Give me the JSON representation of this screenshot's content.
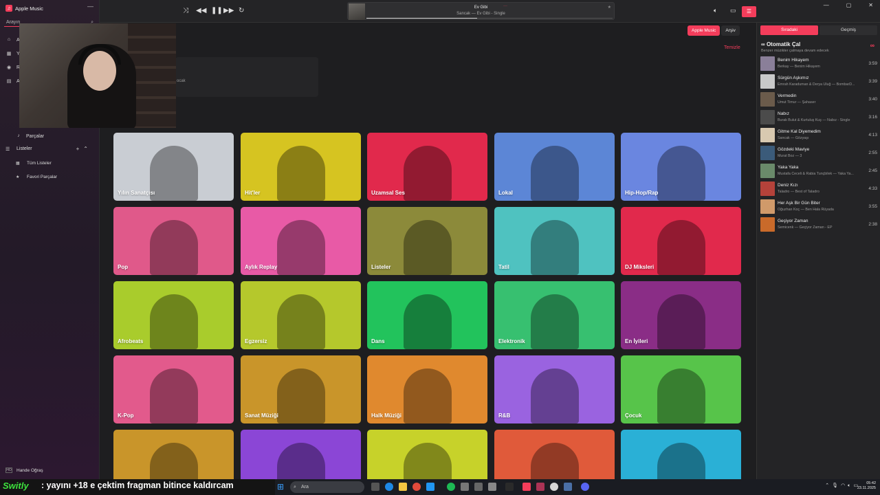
{
  "app": {
    "title": "Apple Music"
  },
  "sidebar": {
    "search_placeholder": "Arayın",
    "nav": [
      {
        "label": "A",
        "icon": "home-icon"
      },
      {
        "label": "Y",
        "icon": "grid-icon"
      },
      {
        "label": "R",
        "icon": "radio-icon"
      },
      {
        "label": "A",
        "icon": "library-icon"
      }
    ],
    "songs_label": "Parçalar",
    "playlists_label": "Listeler",
    "playlists": [
      {
        "label": "Tüm Listeler",
        "icon": "grid-icon"
      },
      {
        "label": "Favori Parçalar",
        "icon": "star-icon"
      }
    ],
    "user": "Hande Oğraş"
  },
  "player": {
    "title": "Ev Gibi",
    "subtitle": "Sancak — Ev Gibi - Single",
    "progress": 0.45
  },
  "content": {
    "toggle_apple": "Apple Music",
    "toggle_archive": "Arşiv",
    "clear": "Temizle",
    "recent_fragment": "ocak"
  },
  "tiles": [
    {
      "label": "Yılın Sanatçısı",
      "color": "#c9cdd3"
    },
    {
      "label": "Hit'ler",
      "color": "#d6c421"
    },
    {
      "label": "Uzamsal Ses",
      "color": "#e1294c"
    },
    {
      "label": "Lokal",
      "color": "#5c86d6"
    },
    {
      "label": "Hip-Hop/Rap",
      "color": "#6a86e0"
    },
    {
      "label": "Pop",
      "color": "#e0598a"
    },
    {
      "label": "Aylık Replay",
      "color": "#e85aa6"
    },
    {
      "label": "Listeler",
      "color": "#8c8a3a"
    },
    {
      "label": "Tatil",
      "color": "#4fc2c0"
    },
    {
      "label": "DJ Miksleri",
      "color": "#e1294c"
    },
    {
      "label": "Afrobeats",
      "color": "#a9cc2c"
    },
    {
      "label": "Egzersiz",
      "color": "#b5c82c"
    },
    {
      "label": "Dans",
      "color": "#22c35c"
    },
    {
      "label": "Elektronik",
      "color": "#37c070"
    },
    {
      "label": "En İyileri",
      "color": "#8a2d86"
    },
    {
      "label": "K-Pop",
      "color": "#e25a8c"
    },
    {
      "label": "Sanat Müziği",
      "color": "#c9952a"
    },
    {
      "label": "Halk Müziği",
      "color": "#e0892e"
    },
    {
      "label": "R&B",
      "color": "#9a63e0"
    },
    {
      "label": "Çocuk",
      "color": "#57c44a"
    },
    {
      "label": "",
      "color": "#c9952a"
    },
    {
      "label": "",
      "color": "#8b46d6"
    },
    {
      "label": "",
      "color": "#c7d22a"
    },
    {
      "label": "",
      "color": "#e05a3a"
    },
    {
      "label": "",
      "color": "#2ab0d6"
    }
  ],
  "queue": {
    "tab_next": "Sıradaki",
    "tab_history": "Geçmiş",
    "autoplay_title": "Otomatik Çal",
    "autoplay_sub": "Benzer müzikler çalmaya devam edecek",
    "items": [
      {
        "title": "Benim Hikayem",
        "sub": "Berkay — Benim Hikayem",
        "dur": "3:59",
        "color": "#8a7f99"
      },
      {
        "title": "Sürgün Aşkımız",
        "sub": "Emrah Karaduman & Derya Uluğ — BombarD...",
        "dur": "3:39",
        "color": "#c9c9c9"
      },
      {
        "title": "Vermedin",
        "sub": "Umut Timur — Şahaser",
        "dur": "3:40",
        "color": "#6b5b4b"
      },
      {
        "title": "Nabız",
        "sub": "Burak Bulut & Kurtuluş Kuş — Nabız - Single",
        "dur": "3:16",
        "color": "#4b4b4b"
      },
      {
        "title": "Gitme Kal Diyemedim",
        "sub": "Sancak — Gözyaşı",
        "dur": "4:13",
        "color": "#d8c9b0"
      },
      {
        "title": "Gözdeki Maviye",
        "sub": "Murat Boz — 3",
        "dur": "2:55",
        "color": "#3b5b7a"
      },
      {
        "title": "Yaka Yaka",
        "sub": "Mustafa Ceceli & Rabia Tunçbilek — Yaka Ya...",
        "dur": "2:45",
        "color": "#6a8a6a"
      },
      {
        "title": "Deniz Kızı",
        "sub": "Taladro — Best of Taladro",
        "dur": "4:33",
        "color": "#b5423a"
      },
      {
        "title": "Her Aşk Bir Gün Biter",
        "sub": "Oğuzhan Koç — Ben Hala Rüyada",
        "dur": "3:55",
        "color": "#d09a6a"
      },
      {
        "title": "Geçiyor Zaman",
        "sub": "Semicenk — Geçiyor Zaman - EP",
        "dur": "2:38",
        "color": "#c96a2a"
      }
    ]
  },
  "overlay": {
    "brand": "Switly",
    "message": ": yayını +18 e çektim fragman bitince kaldırcam"
  },
  "taskbar": {
    "search": "Ara",
    "time": "05:42",
    "date": "23.11.2025",
    "tray_icons": [
      "chevron-up-icon",
      "mic-icon",
      "wifi-icon",
      "volume-icon",
      "battery-icon"
    ]
  }
}
